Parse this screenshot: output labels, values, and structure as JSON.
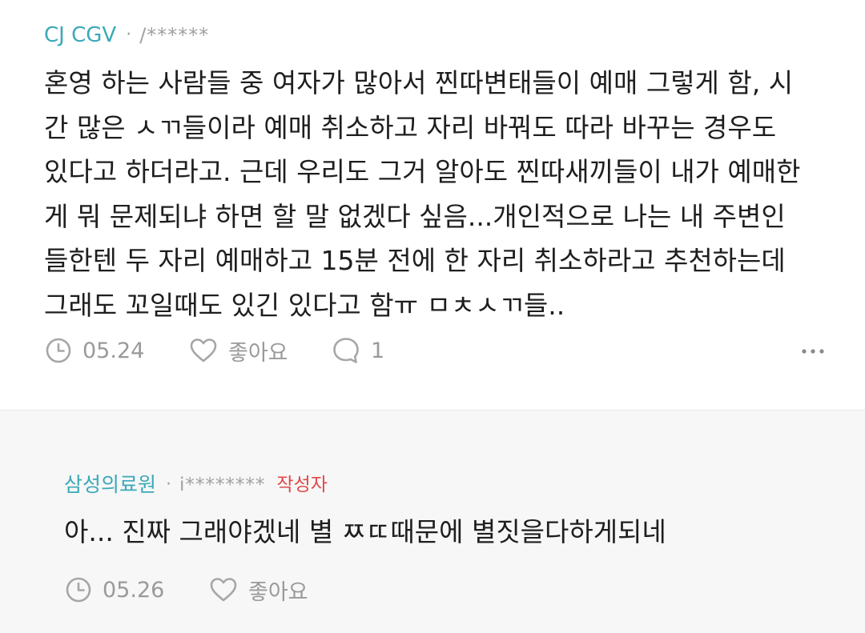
{
  "comment": {
    "company": "CJ CGV",
    "separator": "·",
    "user_id": "/******",
    "lines": [
      "혼영 하는 사람들 중 여자가 많아서 찐따변태들이 예매 그렇게 함, 시",
      "간 많은 ㅅㄲ들이라 예매 취소하고 자리 바꿔도 따라 바꾸는 경우도",
      "있다고 하더라고. 근데 우리도 그거 알아도 찐따새끼들이 내가 예매한",
      "게 뭐 문제되냐 하면 할 말 없겠다 싶음...개인적으로 나는 내 주변인",
      "들한텐 두 자리 예매하고 15분 전에 한 자리 취소하라고 추천하는데",
      "그래도 꼬일때도 있긴 있다고 함ㅠ ㅁㅊㅅㄲ들.."
    ],
    "date": "05.24",
    "like_label": "좋아요",
    "reply_count": "1",
    "icons": {
      "date": "clock-icon",
      "like": "heart-icon",
      "reply": "speech-bubble-icon",
      "more": "more-dots-icon"
    }
  },
  "reply": {
    "company": "삼성의료원",
    "separator": "·",
    "user_id": "i********",
    "author_badge": "작성자",
    "text": "아... 진짜 그래야겠네 별 ㅉㄸ때문에 별짓을다하게되네",
    "date": "05.26",
    "like_label": "좋아요"
  },
  "colors": {
    "company": "#3aa9b8",
    "meta_gray": "#a0a0a0",
    "author_badge": "#e04848",
    "reply_background": "#f7f7f7"
  }
}
